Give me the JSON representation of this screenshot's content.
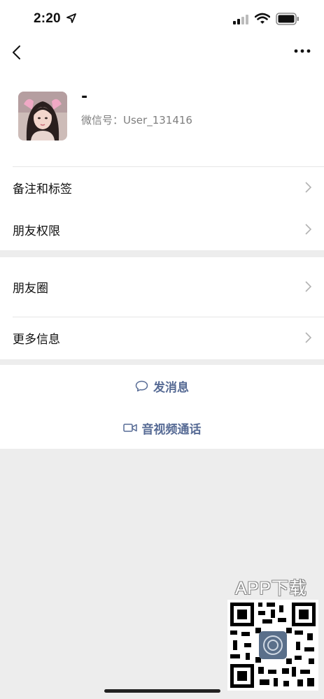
{
  "status_bar": {
    "time": "2:20"
  },
  "profile": {
    "nickname": "-",
    "wechat_id": "微信号：User_131416"
  },
  "menu": {
    "remark_tags": "备注和标签",
    "friend_permissions": "朋友权限",
    "moments": "朋友圈",
    "more_info": "更多信息"
  },
  "actions": {
    "send_message": "发消息",
    "video_call": "音视频通话"
  },
  "watermark": {
    "text": "APP下载"
  },
  "colors": {
    "link": "#576b95",
    "background": "#ededed"
  }
}
